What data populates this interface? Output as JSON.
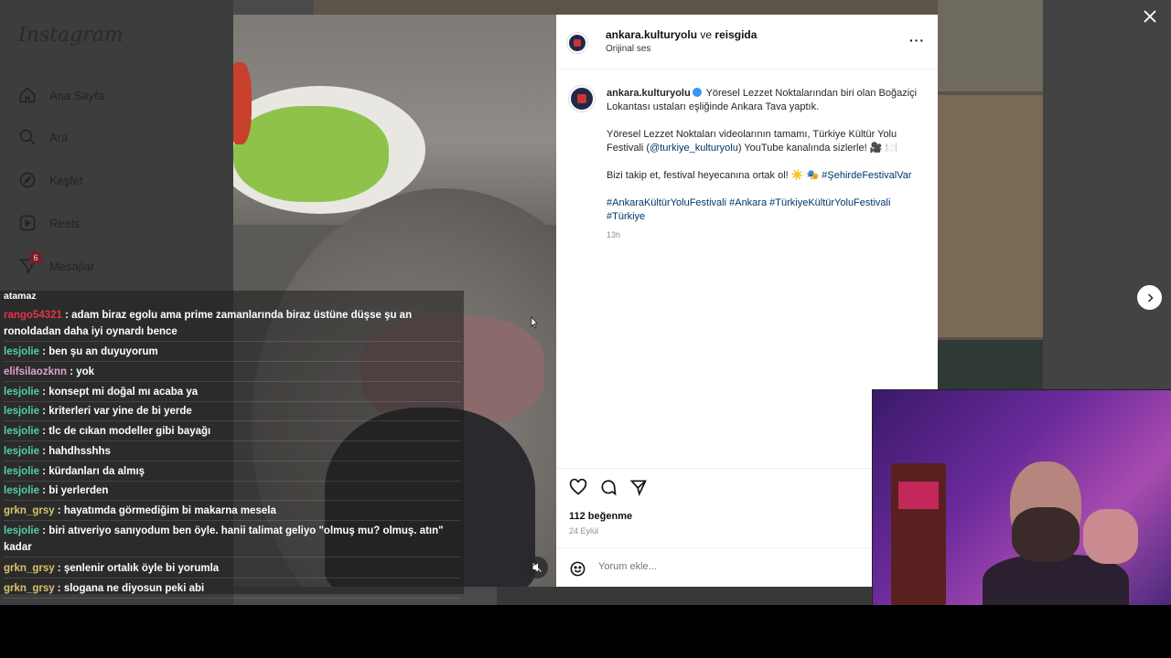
{
  "sidebar": {
    "logo": "Instagram",
    "items": [
      {
        "label": "Ana Sayfa",
        "icon": "home-icon"
      },
      {
        "label": "Ara",
        "icon": "search-icon"
      },
      {
        "label": "Keşfet",
        "icon": "compass-icon"
      },
      {
        "label": "Reels",
        "icon": "reels-icon"
      },
      {
        "label": "Mesajlar",
        "icon": "messenger-icon",
        "badge": "6"
      }
    ]
  },
  "post": {
    "header": {
      "user": "ankara.kulturyolu",
      "connector": "ve",
      "collaborator": "reisgida",
      "audio": "Orijinal ses"
    },
    "caption": {
      "username": "ankara.kulturyolu",
      "line1": "Yöresel Lezzet Noktalarından biri olan Boğaziçi Lokantası ustaları eşliğinde Ankara Tava yaptık.",
      "line2a": "Yöresel Lezzet Noktaları videolarının tamamı, Türkiye Kültür Yolu Festivali (",
      "mention": "@turkiye_kulturyolu",
      "line2b": ") YouTube kanalında sizlerle! 🎥 🍽️",
      "line3a": "Bizi takip et, festival heyecanına ortak ol! ☀️ 🎭",
      "tag1": "#ŞehirdeFestivalVar",
      "tags2": "#AnkaraKültürYoluFestivali #Ankara #TürkiyeKültürYoluFestivali #Türkiye"
    },
    "time": "13h",
    "likes": "112 beğenme",
    "date": "24 Eylül",
    "comment_placeholder": "Yorum ekle...",
    "more_label": "···"
  },
  "chat": {
    "top": "atamaz",
    "messages": [
      {
        "user": "rango54321",
        "color": "#e2334a",
        "text": ": adam biraz egolu ama prime zamanlarında biraz üstüne düşse şu an ronoldadan daha iyi oynardı bence"
      },
      {
        "user": "lesjolie",
        "color": "#4fd1a5",
        "text": ": ben şu an duyuyorum"
      },
      {
        "user": "elifsilaozknn",
        "color": "#e0a0d0",
        "text": ": yok"
      },
      {
        "user": "lesjolie",
        "color": "#4fd1a5",
        "text": ": konsept mi doğal mı acaba ya"
      },
      {
        "user": "lesjolie",
        "color": "#4fd1a5",
        "text": ": kriterleri var yine de bi yerde"
      },
      {
        "user": "lesjolie",
        "color": "#4fd1a5",
        "text": ": tlc de cıkan modeller gibi bayağı"
      },
      {
        "user": "lesjolie",
        "color": "#4fd1a5",
        "text": ": hahdhsshhs"
      },
      {
        "user": "lesjolie",
        "color": "#4fd1a5",
        "text": ": kürdanları da almış"
      },
      {
        "user": "lesjolie",
        "color": "#4fd1a5",
        "text": ": bi yerlerden"
      },
      {
        "user": "grkn_grsy",
        "color": "#d9c36a",
        "text": ": hayatımda görmediğim bi makarna mesela"
      },
      {
        "user": "lesjolie",
        "color": "#4fd1a5",
        "text": ": biri atıveriyo sanıyodum ben öyle. hanii talimat geliyo \"olmuş mu? olmuş. atın\" kadar"
      },
      {
        "user": "grkn_grsy",
        "color": "#d9c36a",
        "text": ": şenlenir ortalık öyle bi yorumla"
      },
      {
        "user": "grkn_grsy",
        "color": "#d9c36a",
        "text": ": slogana ne diyosun peki abi"
      }
    ]
  }
}
